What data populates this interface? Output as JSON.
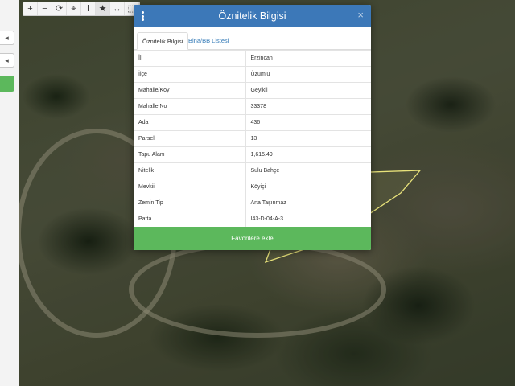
{
  "toolbar": {
    "tools": [
      {
        "icon": "plus-icon",
        "glyph": "+"
      },
      {
        "icon": "minus-icon",
        "glyph": "−"
      },
      {
        "icon": "refresh-icon",
        "glyph": "⟳"
      },
      {
        "icon": "locate-icon",
        "glyph": "⌖"
      },
      {
        "icon": "info-icon",
        "glyph": "i"
      },
      {
        "icon": "star-icon",
        "glyph": "★"
      },
      {
        "icon": "measure-icon",
        "glyph": "↔"
      },
      {
        "icon": "area-icon",
        "glyph": "⬚"
      }
    ]
  },
  "modal": {
    "title": "Öznitelik Bilgisi",
    "close_glyph": "×",
    "tabs": [
      "Öznitelik Bilgisi",
      "Bina/BB Listesi"
    ],
    "rows": [
      {
        "key": "İl",
        "value": "Erzincan"
      },
      {
        "key": "İlçe",
        "value": "Üzümlü"
      },
      {
        "key": "Mahalle/Köy",
        "value": "Geyikli"
      },
      {
        "key": "Mahalle No",
        "value": "33378"
      },
      {
        "key": "Ada",
        "value": "436"
      },
      {
        "key": "Parsel",
        "value": "13"
      },
      {
        "key": "Tapu Alanı",
        "value": "1,615.49"
      },
      {
        "key": "Nitelik",
        "value": "Sulu Bahçe"
      },
      {
        "key": "Mevkii",
        "value": "Köyiçi"
      },
      {
        "key": "Zemin Tip",
        "value": "Ana Taşınmaz"
      },
      {
        "key": "Pafta",
        "value": "I43-D-04-A-3"
      }
    ],
    "favorite_label": "Favorilere ekle"
  },
  "colors": {
    "header": "#3c78b8",
    "favorite": "#5cb85c",
    "parcel_outline": "#e8e27a"
  }
}
